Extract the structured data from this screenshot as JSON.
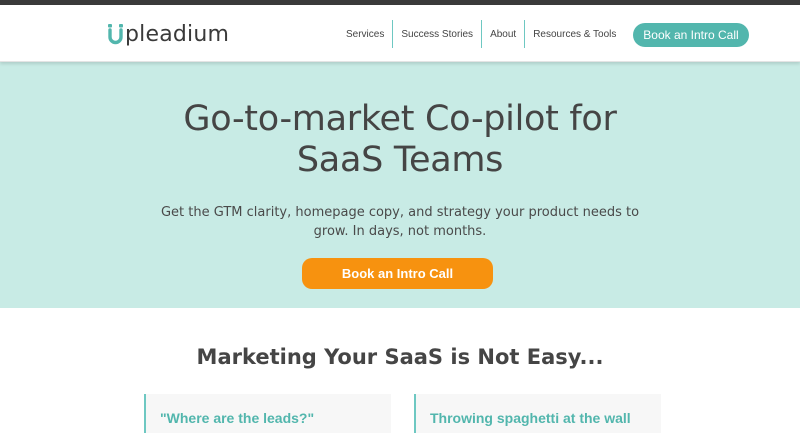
{
  "header": {
    "logo_text": "pleadium",
    "nav": [
      "Services",
      "Success Stories",
      "About",
      "Resources & Tools"
    ],
    "cta_label": "Book an Intro Call"
  },
  "hero": {
    "title_line1": "Go-to-market Co-pilot for",
    "title_line2": "SaaS Teams",
    "subtitle_line1": "Get the GTM clarity, homepage copy, and strategy your product needs to",
    "subtitle_line2": "grow. In days, not months.",
    "cta_label": "Book an Intro Call"
  },
  "section": {
    "title": "Marketing Your SaaS is Not Easy..."
  },
  "cards": [
    {
      "title": "\"Where are the leads?\""
    },
    {
      "title": "Throwing spaghetti at the wall"
    }
  ],
  "colors": {
    "brand_teal": "#52b6ad",
    "hero_bg": "#c8ebe5",
    "cta_orange": "#f7920f"
  }
}
